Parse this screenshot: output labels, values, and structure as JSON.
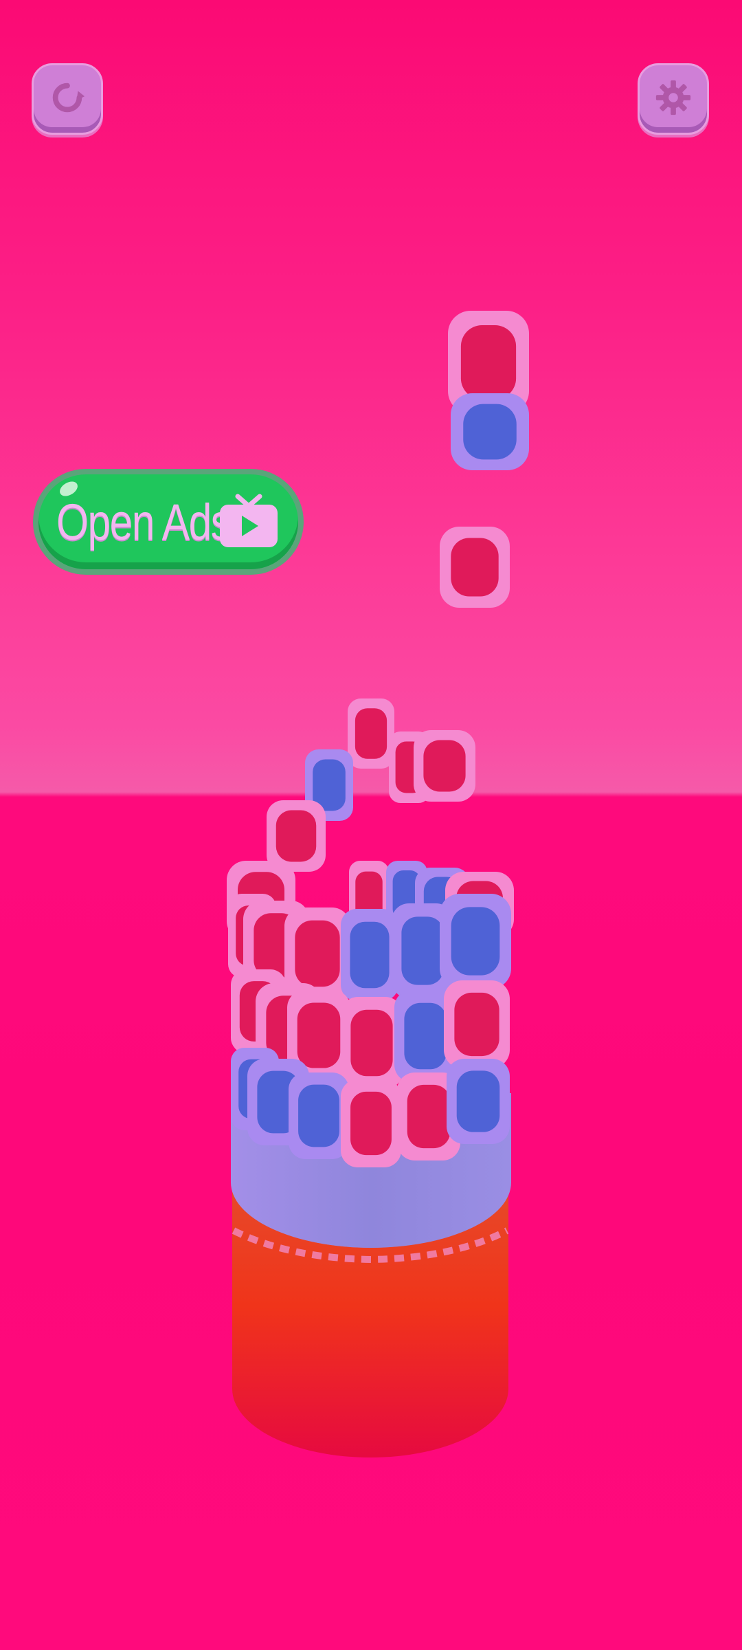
{
  "app": {
    "restart_button": {
      "icon": "restart-icon"
    },
    "settings_button": {
      "icon": "gear-icon"
    },
    "ads_button": {
      "label": "Open Ads",
      "icon": "tv-play-icon"
    }
  },
  "colors": {
    "background": "#fb0a74",
    "floor": "#fe087a",
    "button_green": "#1fc65c",
    "cube_red": "#e01a5a",
    "cube_blue": "#4f62d6",
    "cube_pink_shell": "#f58ad0",
    "cube_violet_shell": "#a98af0"
  }
}
